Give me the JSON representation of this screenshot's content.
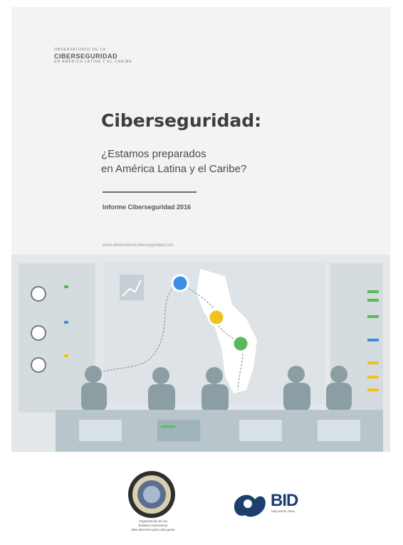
{
  "cover": {
    "series_small_top": "OBSERVATORIO DE LA",
    "series_big": "CIBERSEGURIDAD",
    "series_small_bottom": "EN AMÉRICA LATINA Y EL CARIBE",
    "title": "Ciberseguridad:",
    "subtitle_line1": "¿Estamos preparados",
    "subtitle_line2": "en América Latina y el Caribe?",
    "report": "Informe Ciberseguridad 2016",
    "url": "www.observatoriociberseguridad.com"
  },
  "logos": {
    "oea_line1": "Organización de los",
    "oea_line2": "Estados Americanos",
    "oea_line3": "Más derechos para más gente",
    "bid_name": "BID",
    "bid_sub": "Mejorando vidas"
  },
  "colors": {
    "accent_blue": "#3a8ee6",
    "accent_yellow": "#f0c21f",
    "accent_green": "#5cb85c",
    "silhouette": "#8b9ea4"
  }
}
